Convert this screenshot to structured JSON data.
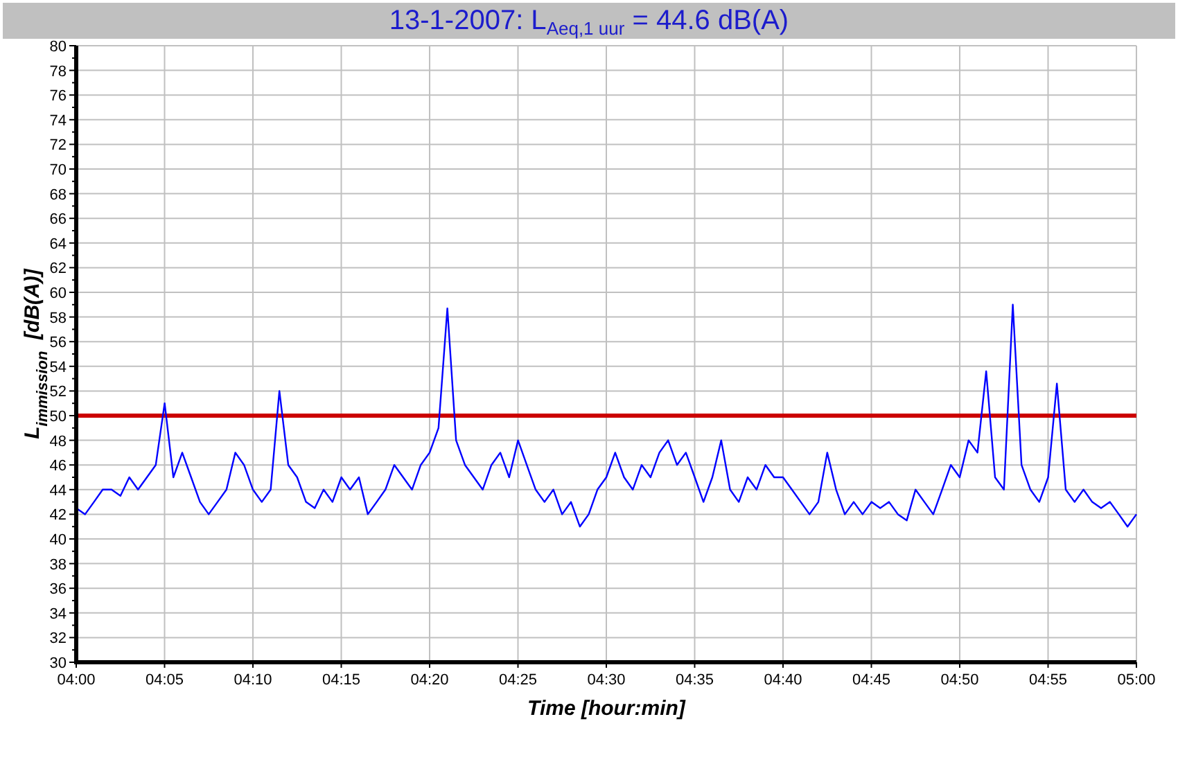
{
  "chart": {
    "chart_data": {
      "type": "line",
      "title": "13-1-2007: L$_{Aeq,1 uur}$ = 44.6 dB(A)",
      "xlabel": "Time [hour:min]",
      "ylabel": "L$_{immission}$  [dB(A)]",
      "categories": [
        "04:00",
        null,
        null,
        null,
        null,
        null,
        null,
        null,
        null,
        null,
        "04:05",
        null,
        null,
        null,
        null,
        null,
        null,
        null,
        null,
        null,
        "04:10",
        null,
        null,
        null,
        null,
        null,
        null,
        null,
        null,
        null,
        "04:15",
        null,
        null,
        null,
        null,
        null,
        null,
        null,
        null,
        null,
        "04:20",
        null,
        null,
        null,
        null,
        null,
        null,
        null,
        null,
        null,
        "04:25",
        null,
        null,
        null,
        null,
        null,
        null,
        null,
        null,
        null,
        "04:30",
        null,
        null,
        null,
        null,
        null,
        null,
        null,
        null,
        null,
        "04:35",
        null,
        null,
        null,
        null,
        null,
        null,
        null,
        null,
        null,
        "04:40",
        null,
        null,
        null,
        null,
        null,
        null,
        null,
        null,
        null,
        "04:45",
        null,
        null,
        null,
        null,
        null,
        null,
        null,
        null,
        null,
        "04:50",
        null,
        null,
        null,
        null,
        null,
        null,
        null,
        null,
        null,
        "04:55",
        null,
        null,
        null,
        null,
        null,
        null,
        null,
        null,
        null,
        "05:00"
      ],
      "values": [
        42.5,
        42,
        43,
        44,
        44,
        43.5,
        45,
        44,
        45,
        46,
        51,
        45,
        47,
        45,
        43,
        42,
        43,
        44,
        47,
        46,
        44,
        43,
        44,
        52,
        46,
        45,
        43,
        42.5,
        44,
        43,
        45,
        44,
        45,
        42,
        43,
        44,
        46,
        45,
        44,
        46,
        47,
        49,
        58.7,
        48,
        46,
        45,
        44,
        46,
        47,
        45,
        48,
        46,
        44,
        43,
        44,
        42,
        43,
        41,
        42,
        44,
        45,
        47,
        45,
        44,
        46,
        45,
        47,
        48,
        46,
        47,
        45,
        43,
        45,
        48,
        44,
        43,
        45,
        44,
        46,
        45,
        45,
        44,
        43,
        42,
        43,
        47,
        44,
        42,
        43,
        42,
        43,
        42.5,
        43,
        42,
        41.5,
        44,
        43,
        42,
        44,
        46,
        45,
        48,
        47,
        53.6,
        45,
        44,
        59,
        46,
        44,
        43,
        45,
        52.6,
        44,
        43,
        44,
        43,
        42.5,
        43,
        42,
        41,
        42
      ],
      "ylim": [
        30,
        80
      ],
      "yticks": [
        80,
        78,
        76,
        74,
        72,
        70,
        68,
        66,
        64,
        62,
        60,
        58,
        56,
        54,
        52,
        50,
        48,
        46,
        44,
        42,
        40,
        38,
        36,
        34,
        32,
        30
      ],
      "grid": true,
      "ref_lines": [
        {
          "axis": "y",
          "value": 50,
          "color": "#cc0000"
        }
      ]
    }
  }
}
